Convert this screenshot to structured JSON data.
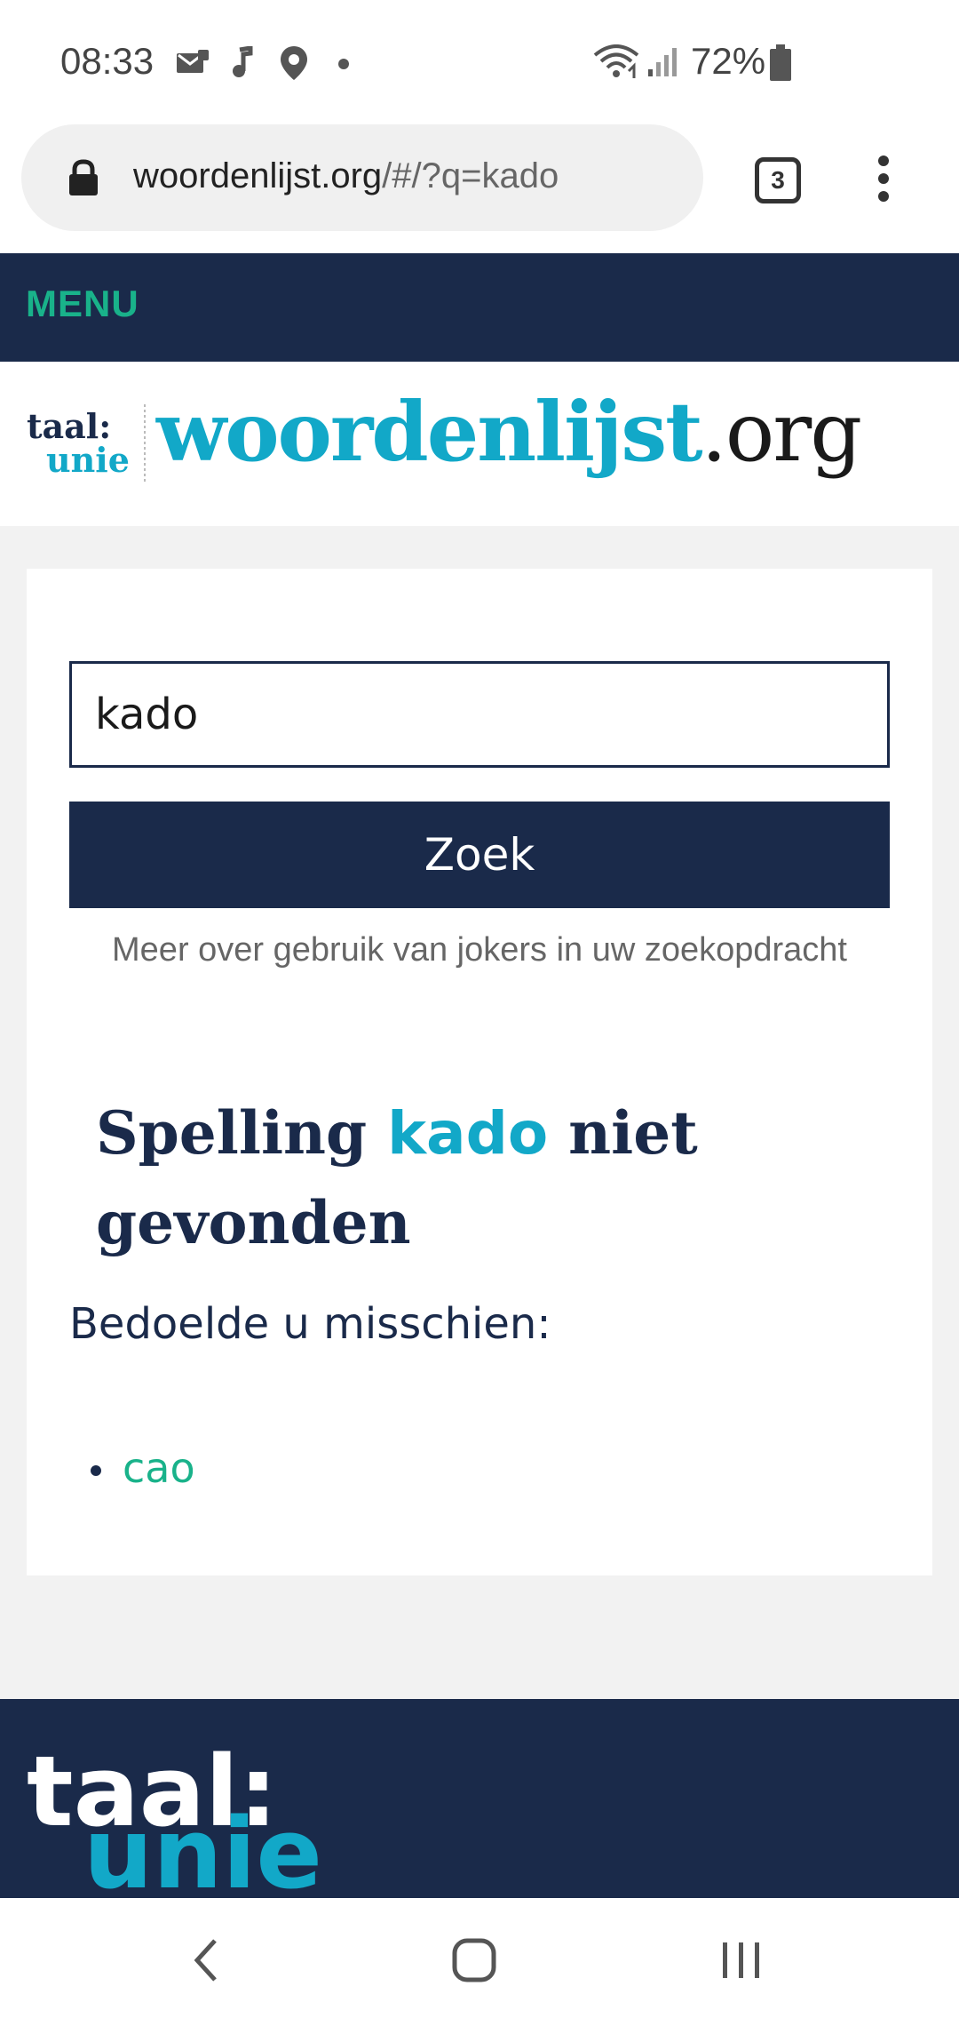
{
  "status_bar": {
    "time": "08:33",
    "battery": "72%",
    "icons": [
      "mail-icon",
      "music-note-icon",
      "location-icon",
      "dot-icon",
      "wifi-icon",
      "signal-icon",
      "battery-icon"
    ]
  },
  "browser": {
    "url_domain": "woordenlijst.org",
    "url_rest": "/#/?q=kado",
    "tab_count": "3"
  },
  "site_nav": {
    "menu_label": "MENU"
  },
  "site_header": {
    "logo_line1": "taal:",
    "logo_line2": "unie",
    "title_main": "woordenlijst",
    "title_tld": ".org"
  },
  "search": {
    "query": "kado",
    "button_label": "Zoek",
    "jokers_link": "Meer over gebruik van jokers in uw zoekopdracht"
  },
  "result": {
    "heading_prefix": "Spelling ",
    "heading_term": "kado",
    "heading_suffix": " niet gevonden",
    "suggestion_label": "Bedoelde u misschien:",
    "suggestions": [
      "cao"
    ]
  },
  "footer": {
    "logo_line1": "taal:",
    "logo_line2": "unie"
  },
  "colors": {
    "navy": "#1a2a4a",
    "teal": "#12a8c8",
    "green": "#19b28a"
  }
}
